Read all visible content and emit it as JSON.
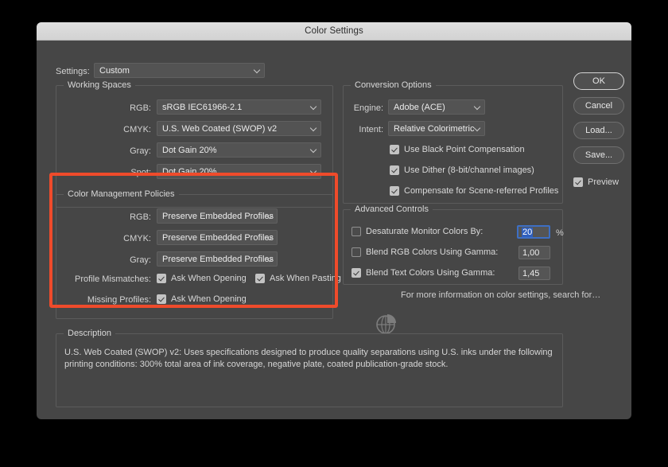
{
  "window": {
    "title": "Color Settings"
  },
  "settings_row": {
    "label": "Settings:",
    "value": "Custom"
  },
  "working_spaces": {
    "legend": "Working Spaces",
    "rows": [
      {
        "label": "RGB:",
        "value": "sRGB IEC61966-2.1"
      },
      {
        "label": "CMYK:",
        "value": "U.S. Web Coated (SWOP) v2"
      },
      {
        "label": "Gray:",
        "value": "Dot Gain 20%"
      },
      {
        "label": "Spot:",
        "value": "Dot Gain 20%"
      }
    ]
  },
  "color_management_policies": {
    "legend": "Color Management Policies",
    "rows": [
      {
        "label": "RGB:",
        "value": "Preserve Embedded Profiles"
      },
      {
        "label": "CMYK:",
        "value": "Preserve Embedded Profiles"
      },
      {
        "label": "Gray:",
        "value": "Preserve Embedded Profiles"
      }
    ],
    "profile_mismatches": {
      "label": "Profile Mismatches:",
      "ask_when_opening": {
        "label": "Ask When Opening",
        "checked": true
      },
      "ask_when_pasting": {
        "label": "Ask When Pasting",
        "checked": true
      }
    },
    "missing_profiles": {
      "label": "Missing Profiles:",
      "ask_when_opening": {
        "label": "Ask When Opening",
        "checked": true
      }
    },
    "highlight_color": "#ef4b2b"
  },
  "conversion_options": {
    "legend": "Conversion Options",
    "engine": {
      "label": "Engine:",
      "value": "Adobe (ACE)"
    },
    "intent": {
      "label": "Intent:",
      "value": "Relative Colorimetric"
    },
    "checkboxes": [
      {
        "label": "Use Black Point Compensation",
        "checked": true
      },
      {
        "label": "Use Dither (8-bit/channel images)",
        "checked": true
      },
      {
        "label": "Compensate for Scene-referred Profiles",
        "checked": true
      }
    ]
  },
  "advanced_controls": {
    "legend": "Advanced Controls",
    "rows": [
      {
        "label": "Desaturate Monitor Colors By:",
        "checked": false,
        "value": "20",
        "suffix": "%",
        "focused": true
      },
      {
        "label": "Blend RGB Colors Using Gamma:",
        "checked": false,
        "value": "1,00",
        "suffix": "",
        "focused": false
      },
      {
        "label": "Blend Text Colors Using Gamma:",
        "checked": true,
        "value": "1,45",
        "suffix": "",
        "focused": false
      }
    ],
    "more_info_text": "For more information on color settings, search for…"
  },
  "buttons": {
    "ok": "OK",
    "cancel": "Cancel",
    "load": "Load...",
    "save": "Save...",
    "preview": {
      "label": "Preview",
      "checked": true
    }
  },
  "description": {
    "legend": "Description",
    "text": "U.S. Web Coated (SWOP) v2:  Uses specifications designed to produce quality separations using U.S. inks under the following printing conditions: 300% total area of ink coverage, negative plate, coated publication-grade stock."
  }
}
